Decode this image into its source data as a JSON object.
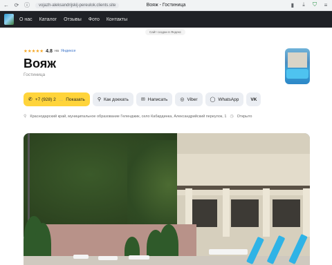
{
  "browser": {
    "url": "vojazh-aleksandrijskij-pereulok.clients.site",
    "page_title": "Вояж - Гостиница"
  },
  "nav": {
    "links": [
      "О нас",
      "Каталог",
      "Отзывы",
      "Фото",
      "Контакты"
    ]
  },
  "created_note": "Сайт создан в Яндекс",
  "header": {
    "stars": "★★★★★",
    "rating": "4.8",
    "rating_on": "на",
    "rating_source": "Яндексе",
    "name": "Вояж",
    "type": "Гостиница"
  },
  "actions": {
    "phone_number": "+7 (928) 2",
    "phone_show": "Показать",
    "route": "Как доехать",
    "write": "Написать",
    "viber": "Viber",
    "whatsapp": "WhatsApp",
    "vk": "VK"
  },
  "address": {
    "text": "Краснодарский край, муниципальное образование Геленджик, село Кабардинка, Александрийский переулок, 1",
    "status": "Открыто"
  },
  "colors": {
    "nav_bg": "#1f2126",
    "phone_button": "#ffd43b",
    "button_bg": "#ebeef3",
    "star": "#f5a623"
  }
}
